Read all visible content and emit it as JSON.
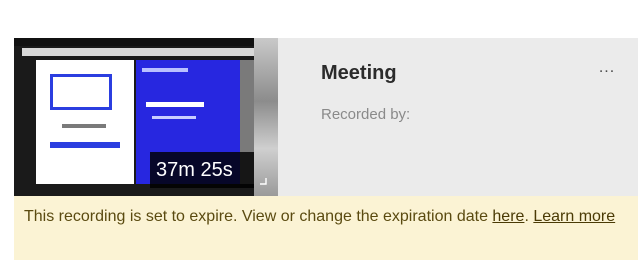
{
  "recording": {
    "title": "Meeting",
    "recorded_by_label": "Recorded by:",
    "duration": "37m 25s",
    "more_label": "...",
    "thumbnail_icon": "screen-share-thumbnail"
  },
  "banner": {
    "text_before": "This recording is set to expire. View or change the expiration date ",
    "here_link": "here",
    "text_middle": ". ",
    "learn_more_link": "Learn more"
  },
  "colors": {
    "card_bg": "#ebebeb",
    "banner_bg": "#fbf3d4",
    "thumbnail_blue": "#2727e0"
  }
}
